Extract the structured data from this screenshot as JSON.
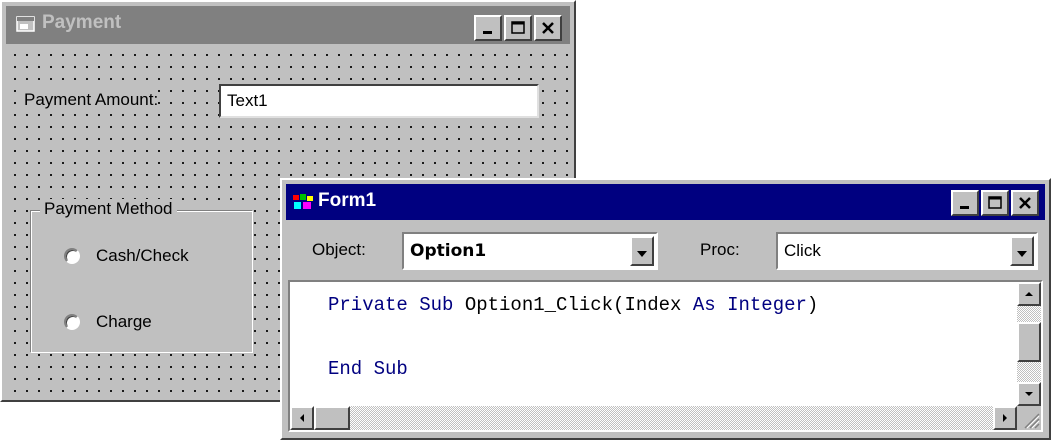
{
  "payment_window": {
    "title": "Payment",
    "amount_label": "Payment Amount:",
    "amount_value": "Text1",
    "frame_label": "Payment Method",
    "options": [
      {
        "label": "Cash/Check",
        "selected": false
      },
      {
        "label": "Charge",
        "selected": false
      }
    ]
  },
  "code_window": {
    "title": "Form1",
    "object_label": "Object:",
    "object_value": "Option1",
    "proc_label": "Proc:",
    "proc_value": "Click",
    "code_lines": [
      {
        "kw1": "Private Sub",
        "mid": " Option1_Click(Index ",
        "kw2": "As Integer",
        "tail": ")"
      },
      {
        "kw1": "",
        "mid": "",
        "kw2": "",
        "tail": ""
      },
      {
        "kw1": "End Sub",
        "mid": "",
        "kw2": "",
        "tail": ""
      }
    ]
  },
  "colors": {
    "active_title": "#000080",
    "inactive_title": "#808080",
    "keyword": "#000080"
  }
}
